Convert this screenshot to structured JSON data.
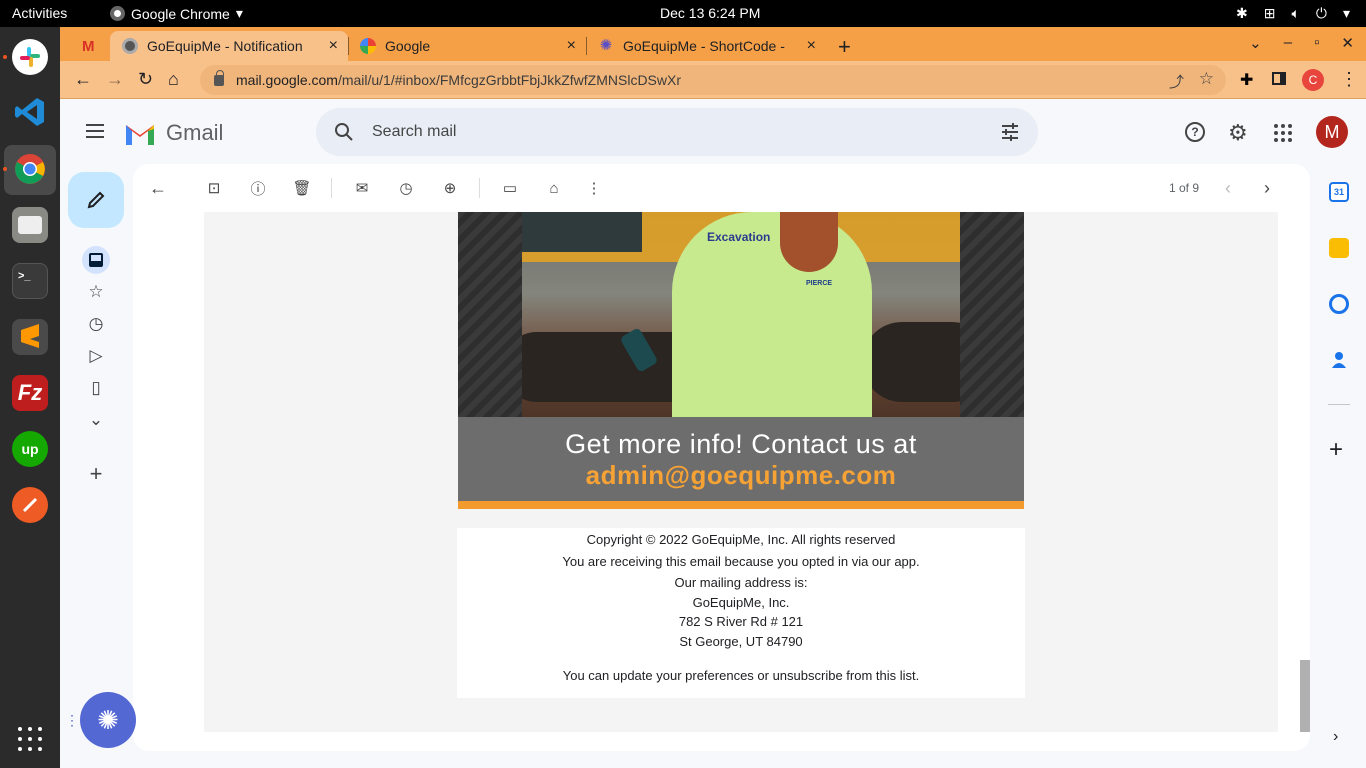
{
  "system": {
    "activities": "Activities",
    "app_name": "Google Chrome",
    "clock": "Dec 13  6:24 PM"
  },
  "dock": {
    "items": [
      "slack",
      "vscode",
      "chrome",
      "files",
      "terminal",
      "sublime-text",
      "filezilla",
      "upwork",
      "postman",
      "show-applications"
    ]
  },
  "browser": {
    "tabs": [
      {
        "title": "GoEquipMe - Notification",
        "favicon": "gmail-icon",
        "active": true
      },
      {
        "title": "Google",
        "favicon": "google-icon",
        "active": false
      },
      {
        "title": "GoEquipMe - ShortCode -",
        "favicon": "wordpress-icon",
        "active": false
      }
    ],
    "tab_close": "×",
    "new_tab": "+",
    "url_host": "mail.google.com",
    "url_path": "/mail/u/1/#inbox/FMfcgzGrbbtFbjJkkZfwfZMNSlcDSwXr",
    "profile_initial": "C"
  },
  "gmail": {
    "wordmark": "Gmail",
    "search_placeholder": "Search mail",
    "account_initial": "M",
    "pager": "1 of 9"
  },
  "email": {
    "hero_sign": "Excavation",
    "shirt_logo": "PIERCE",
    "cta_line1": "Get more info! Contact us at",
    "cta_line2": "admin@goequipme.com",
    "footer": {
      "copyright": "Copyright © 2022 GoEquipMe, Inc. All rights reserved",
      "reason": "You are receiving this email because you opted in via our app.",
      "mailing_label": "Our mailing address is:",
      "company": "GoEquipMe, Inc.",
      "street": "782 S River Rd # 121",
      "city": "St George, UT 84790",
      "unsubscribe": "You can update your preferences or unsubscribe from this list."
    }
  },
  "colors": {
    "tabstrip": "#f5a047",
    "toolbar": "#f9c18a",
    "cta_orange": "#f7a234",
    "cta_band": "#6d6d6d",
    "compose": "#c2e7ff",
    "avatar": "#b3261e"
  }
}
